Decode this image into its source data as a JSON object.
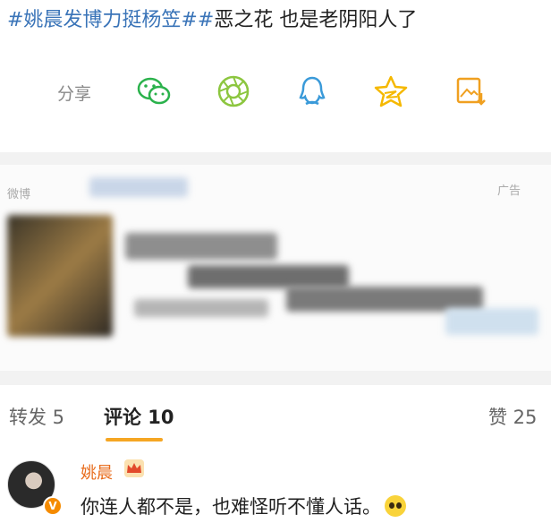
{
  "post": {
    "hashtag1": "#姚晨发博力挺杨笠#",
    "hashtag2_part": "恶之花",
    "text_rest": " 也是老阴阳人了"
  },
  "share": {
    "label": "分享",
    "icons": [
      "wechat-icon",
      "moments-icon",
      "qq-icon",
      "qzone-icon",
      "save-image-icon"
    ],
    "colors": {
      "wechat": "#2bb24c",
      "moments": "#8cc63f",
      "qq": "#3a9ad9",
      "qzone": "#f5b800",
      "save": "#f0a020"
    }
  },
  "ad": {
    "left_hint": "微博",
    "right_hint": "广告"
  },
  "tabs": {
    "repost": "转发 5",
    "comment": "评论 10",
    "like": "赞 25"
  },
  "comment": {
    "author": "姚晨",
    "text": "你连人都不是，也难怪听不懂人话。",
    "verified_badge": "V"
  },
  "colors": {
    "hashtag": "#3a74b8",
    "accent": "#f5a623",
    "author": "#e86b1b"
  }
}
